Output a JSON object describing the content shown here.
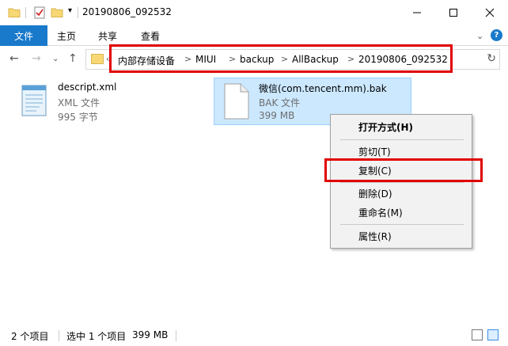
{
  "window": {
    "title": "20190806_092532"
  },
  "ribbon": {
    "tabs": [
      "文件",
      "主页",
      "共享",
      "查看"
    ]
  },
  "address": {
    "crumbs": [
      "内部存储设备",
      "MIUI",
      "backup",
      "AllBackup",
      "20190806_092532"
    ],
    "separator": ">"
  },
  "files": [
    {
      "name": "descript.xml",
      "type": "XML 文件",
      "size": "995 字节"
    },
    {
      "name": "微信(com.tencent.mm).bak",
      "type": "BAK 文件",
      "size": "399 MB"
    }
  ],
  "context_menu": {
    "open_with": "打开方式(H)",
    "cut": "剪切(T)",
    "copy": "复制(C)",
    "delete": "删除(D)",
    "rename": "重命名(M)",
    "properties": "属性(R)"
  },
  "status": {
    "item_count": "2 个项目",
    "selected": "选中 1 个项目",
    "selected_size": "399 MB"
  },
  "colors": {
    "accent": "#1979ca",
    "selection": "#cce8ff",
    "highlight_box": "#e00000"
  }
}
